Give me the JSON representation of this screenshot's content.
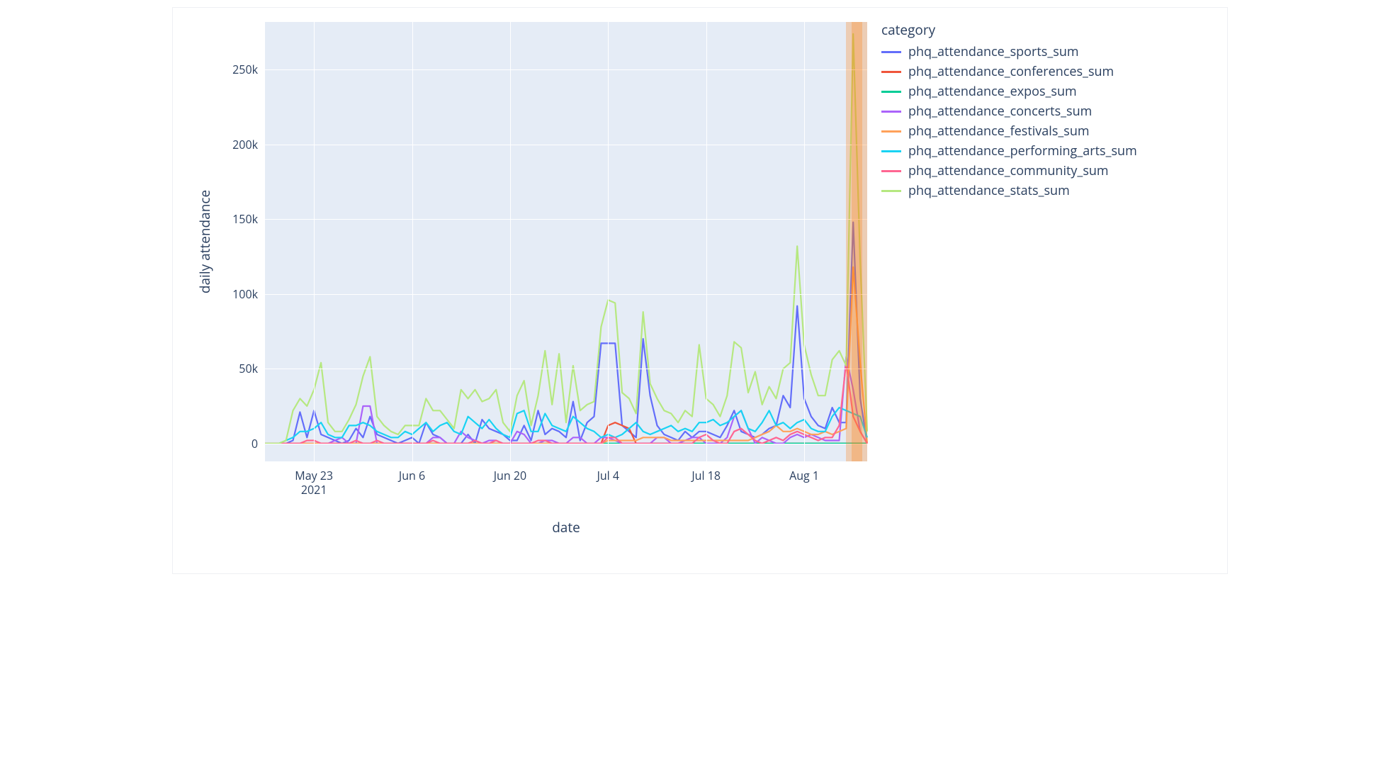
{
  "legend_title": "category",
  "xlabel": "date",
  "ylabel": "daily attendance",
  "x_ticks": [
    {
      "label": "May 23\n2021",
      "dayIndex": 7
    },
    {
      "label": "Jun 6",
      "dayIndex": 21
    },
    {
      "label": "Jun 20",
      "dayIndex": 35
    },
    {
      "label": "Jul 4",
      "dayIndex": 49
    },
    {
      "label": "Jul 18",
      "dayIndex": 63
    },
    {
      "label": "Aug 1",
      "dayIndex": 77
    }
  ],
  "y_ticks": [
    0,
    50000,
    100000,
    150000,
    200000,
    250000
  ],
  "chart_data": {
    "type": "line",
    "xlabel": "date",
    "ylabel": "daily attendance",
    "x_start": "2021-05-16",
    "x_end": "2021-08-10",
    "x_day_count": 87,
    "ylim": [
      -12000,
      282000
    ],
    "series": [
      {
        "name": "phq_attendance_sports_sum",
        "color": "#636efa",
        "values": [
          0,
          0,
          0,
          0,
          2000,
          21000,
          4000,
          22000,
          6000,
          4000,
          2000,
          0,
          2000,
          10000,
          4000,
          18000,
          6000,
          4000,
          2000,
          0,
          2000,
          4000,
          0,
          14000,
          6000,
          4000,
          0,
          0,
          0,
          6000,
          0,
          16000,
          10000,
          8000,
          6000,
          2000,
          2000,
          12000,
          2000,
          22000,
          6000,
          10000,
          8000,
          4000,
          28000,
          2000,
          14000,
          18000,
          67000,
          67000,
          67000,
          12000,
          8000,
          4000,
          70000,
          32000,
          12000,
          6000,
          4000,
          2000,
          8000,
          4000,
          8000,
          8000,
          6000,
          4000,
          12000,
          22000,
          8000,
          6000,
          4000,
          6000,
          10000,
          12000,
          32000,
          24000,
          92000,
          30000,
          18000,
          12000,
          10000,
          24000,
          14000,
          14000,
          148000,
          30000,
          0
        ]
      },
      {
        "name": "phq_attendance_conferences_sum",
        "color": "#EF553B",
        "values": [
          0,
          0,
          0,
          0,
          0,
          0,
          0,
          0,
          0,
          0,
          0,
          0,
          0,
          0,
          0,
          0,
          0,
          0,
          0,
          0,
          0,
          0,
          0,
          0,
          0,
          0,
          0,
          0,
          0,
          0,
          0,
          0,
          0,
          0,
          0,
          0,
          0,
          0,
          0,
          0,
          0,
          0,
          0,
          0,
          0,
          0,
          0,
          0,
          0,
          12000,
          14000,
          12000,
          10000,
          0,
          0,
          0,
          0,
          0,
          0,
          0,
          0,
          0,
          0,
          0,
          0,
          0,
          0,
          0,
          0,
          0,
          0,
          0,
          0,
          0,
          0,
          0,
          0,
          0,
          0,
          0,
          0,
          0,
          0,
          0,
          0,
          0,
          0
        ]
      },
      {
        "name": "phq_attendance_expos_sum",
        "color": "#00cc96",
        "values": [
          0,
          0,
          0,
          0,
          0,
          0,
          0,
          0,
          0,
          0,
          0,
          0,
          0,
          0,
          0,
          0,
          0,
          0,
          0,
          0,
          0,
          0,
          0,
          0,
          0,
          0,
          0,
          0,
          0,
          0,
          0,
          0,
          0,
          0,
          0,
          0,
          0,
          0,
          0,
          0,
          0,
          0,
          0,
          0,
          0,
          0,
          0,
          0,
          0,
          0,
          0,
          0,
          0,
          0,
          0,
          0,
          0,
          0,
          0,
          0,
          0,
          0,
          0,
          0,
          0,
          0,
          0,
          0,
          0,
          0,
          0,
          0,
          0,
          0,
          0,
          0,
          0,
          0,
          0,
          0,
          0,
          0,
          0,
          0,
          0,
          0,
          0
        ]
      },
      {
        "name": "phq_attendance_concerts_sum",
        "color": "#ab63fa",
        "values": [
          0,
          0,
          0,
          0,
          0,
          0,
          0,
          0,
          0,
          0,
          2000,
          4000,
          0,
          0,
          25000,
          25000,
          0,
          0,
          0,
          0,
          0,
          0,
          0,
          0,
          4000,
          4000,
          0,
          0,
          8000,
          4000,
          2000,
          0,
          2000,
          2000,
          0,
          0,
          8000,
          6000,
          0,
          0,
          2000,
          2000,
          0,
          0,
          4000,
          4000,
          0,
          0,
          4000,
          4000,
          2000,
          0,
          0,
          0,
          0,
          0,
          4000,
          4000,
          0,
          0,
          2000,
          4000,
          4000,
          0,
          0,
          0,
          4000,
          18000,
          22000,
          10000,
          0,
          4000,
          2000,
          0,
          0,
          4000,
          6000,
          4000,
          6000,
          4000,
          2000,
          2000,
          2000,
          58000,
          36000,
          8000,
          0
        ]
      },
      {
        "name": "phq_attendance_festivals_sum",
        "color": "#FFA15A",
        "values": [
          0,
          0,
          0,
          0,
          0,
          0,
          0,
          0,
          0,
          0,
          0,
          0,
          0,
          0,
          0,
          0,
          0,
          0,
          0,
          0,
          0,
          0,
          0,
          0,
          0,
          0,
          0,
          0,
          0,
          0,
          0,
          0,
          0,
          0,
          0,
          0,
          0,
          0,
          0,
          0,
          0,
          0,
          0,
          0,
          0,
          0,
          0,
          0,
          0,
          2000,
          2000,
          2000,
          2000,
          2000,
          4000,
          4000,
          4000,
          4000,
          2000,
          2000,
          2000,
          2000,
          2000,
          2000,
          2000,
          2000,
          2000,
          2000,
          2000,
          2000,
          4000,
          6000,
          8000,
          12000,
          8000,
          8000,
          10000,
          8000,
          6000,
          6000,
          8000,
          6000,
          8000,
          10000,
          118000,
          54000,
          0
        ]
      },
      {
        "name": "phq_attendance_performing_arts_sum",
        "color": "#19d3f3",
        "values": [
          0,
          0,
          0,
          2000,
          4000,
          8000,
          8000,
          10000,
          14000,
          6000,
          4000,
          4000,
          12000,
          12000,
          14000,
          12000,
          8000,
          6000,
          4000,
          4000,
          8000,
          6000,
          10000,
          14000,
          8000,
          12000,
          14000,
          8000,
          6000,
          18000,
          14000,
          10000,
          16000,
          10000,
          6000,
          4000,
          20000,
          22000,
          8000,
          8000,
          20000,
          12000,
          10000,
          8000,
          18000,
          14000,
          10000,
          8000,
          4000,
          6000,
          4000,
          6000,
          10000,
          14000,
          8000,
          6000,
          8000,
          10000,
          12000,
          8000,
          10000,
          8000,
          14000,
          14000,
          16000,
          12000,
          14000,
          18000,
          22000,
          10000,
          8000,
          14000,
          22000,
          12000,
          14000,
          10000,
          14000,
          16000,
          10000,
          8000,
          8000,
          18000,
          24000,
          22000,
          20000,
          18000,
          4000
        ]
      },
      {
        "name": "phq_attendance_community_sum",
        "color": "#ff6692",
        "values": [
          0,
          0,
          0,
          0,
          0,
          0,
          2000,
          2000,
          0,
          0,
          0,
          0,
          0,
          2000,
          0,
          0,
          2000,
          0,
          0,
          0,
          0,
          0,
          0,
          0,
          2000,
          0,
          0,
          0,
          0,
          0,
          2000,
          0,
          0,
          2000,
          0,
          0,
          0,
          0,
          0,
          2000,
          2000,
          0,
          0,
          0,
          0,
          0,
          0,
          0,
          0,
          4000,
          4000,
          0,
          0,
          0,
          0,
          0,
          0,
          0,
          0,
          0,
          0,
          0,
          4000,
          6000,
          2000,
          0,
          0,
          8000,
          10000,
          6000,
          2000,
          0,
          2000,
          4000,
          2000,
          6000,
          8000,
          6000,
          4000,
          2000,
          4000,
          4000,
          12000,
          54000,
          18000,
          8000,
          0
        ]
      },
      {
        "name": "phq_attendance_stats_sum",
        "color": "#b6e880",
        "values": [
          0,
          0,
          0,
          2000,
          22000,
          30000,
          25000,
          36000,
          54000,
          14000,
          8000,
          8000,
          16000,
          26000,
          45000,
          58000,
          18000,
          12000,
          8000,
          6000,
          12000,
          12000,
          12000,
          30000,
          22000,
          22000,
          16000,
          10000,
          36000,
          30000,
          36000,
          28000,
          30000,
          36000,
          14000,
          8000,
          32000,
          42000,
          12000,
          32000,
          62000,
          26000,
          60000,
          14000,
          52000,
          22000,
          26000,
          28000,
          78000,
          96000,
          94000,
          34000,
          30000,
          20000,
          88000,
          40000,
          30000,
          22000,
          20000,
          14000,
          22000,
          18000,
          66000,
          30000,
          26000,
          18000,
          32000,
          68000,
          64000,
          34000,
          48000,
          26000,
          38000,
          30000,
          50000,
          54000,
          132000,
          66000,
          46000,
          32000,
          32000,
          56000,
          62000,
          52000,
          274000,
          122000,
          8000
        ]
      }
    ],
    "highlight_band_days": [
      83,
      86
    ]
  }
}
